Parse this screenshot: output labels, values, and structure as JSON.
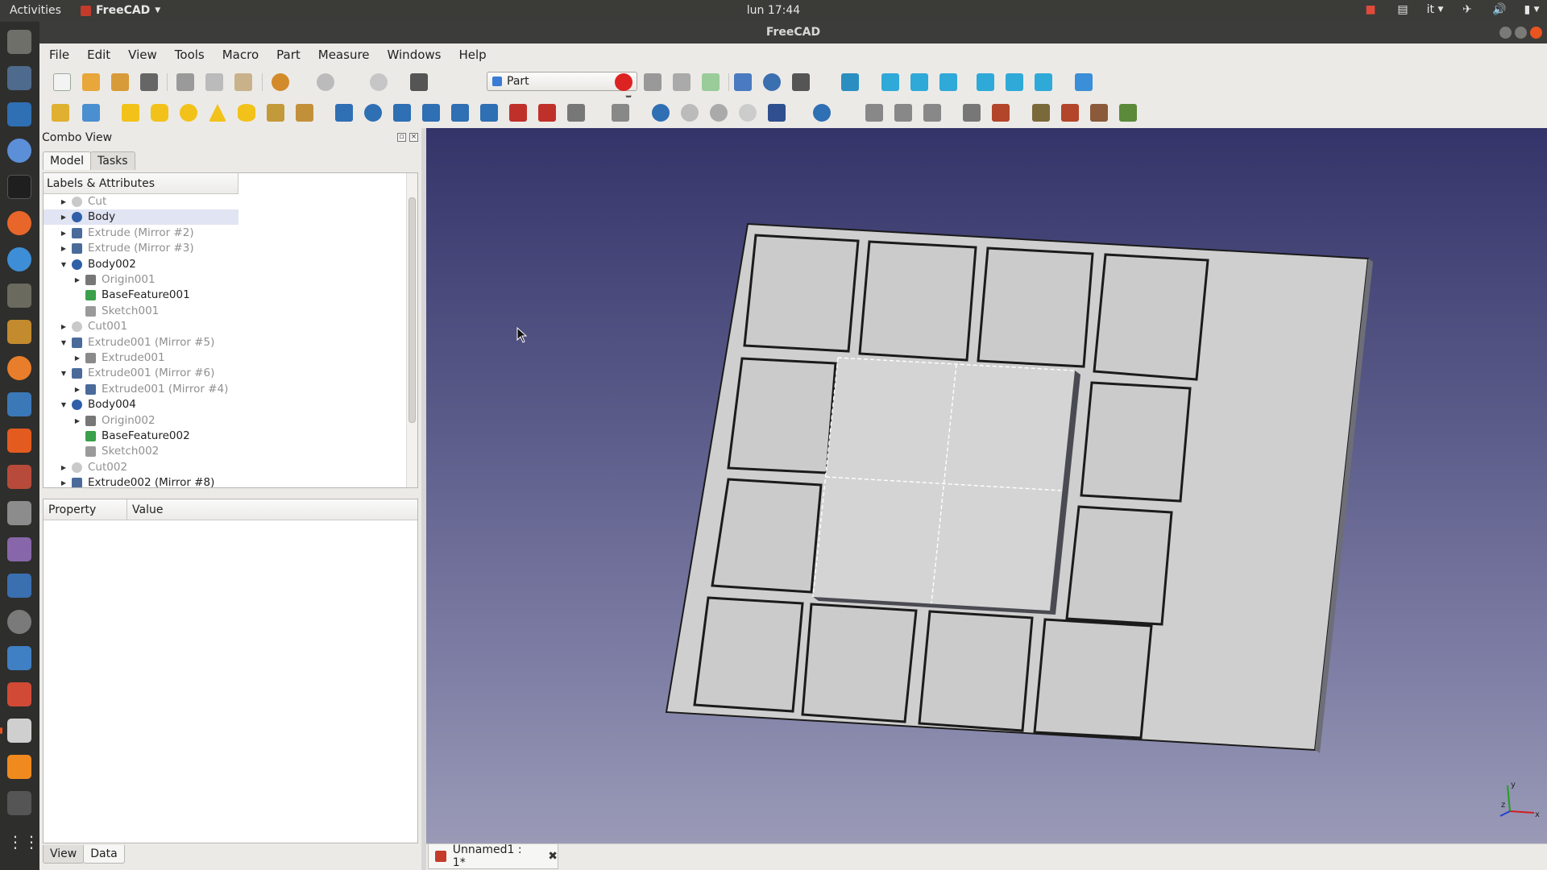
{
  "topbar": {
    "activities": "Activities",
    "app_menu": "FreeCAD",
    "clock": "lun 17:44",
    "keyboard_layout": "it"
  },
  "window": {
    "title": "FreeCAD"
  },
  "menu": [
    "File",
    "Edit",
    "View",
    "Tools",
    "Macro",
    "Part",
    "Measure",
    "Windows",
    "Help"
  ],
  "toolbar": {
    "workbench": "Part"
  },
  "combo": {
    "title": "Combo View",
    "tabs": [
      "Model",
      "Tasks"
    ],
    "tree_header": "Labels & Attributes",
    "items": [
      {
        "label": "Cut",
        "depth": 0,
        "expander": "closed",
        "dim": true,
        "icon": "cut-icon"
      },
      {
        "label": "Body",
        "depth": 0,
        "expander": "closed",
        "dim": false,
        "selected": true,
        "icon": "body-icon"
      },
      {
        "label": "Extrude (Mirror #2)",
        "depth": 0,
        "expander": "closed",
        "dim": true,
        "icon": "mirror-icon"
      },
      {
        "label": "Extrude (Mirror #3)",
        "depth": 0,
        "expander": "closed",
        "dim": true,
        "icon": "mirror-icon"
      },
      {
        "label": "Body002",
        "depth": 0,
        "expander": "open",
        "dim": false,
        "icon": "body-icon"
      },
      {
        "label": "Origin001",
        "depth": 1,
        "expander": "closed",
        "dim": true,
        "icon": "origin-icon"
      },
      {
        "label": "BaseFeature001",
        "depth": 1,
        "expander": "none",
        "dim": false,
        "icon": "base-feature-icon"
      },
      {
        "label": "Sketch001",
        "depth": 1,
        "expander": "none",
        "dim": true,
        "icon": "sketch-icon"
      },
      {
        "label": "Cut001",
        "depth": 0,
        "expander": "closed",
        "dim": true,
        "icon": "cut-icon"
      },
      {
        "label": "Extrude001 (Mirror #5)",
        "depth": 0,
        "expander": "open",
        "dim": true,
        "icon": "mirror-icon"
      },
      {
        "label": "Extrude001",
        "depth": 1,
        "expander": "closed",
        "dim": true,
        "icon": "extrude-icon"
      },
      {
        "label": "Extrude001 (Mirror #6)",
        "depth": 0,
        "expander": "open",
        "dim": true,
        "icon": "mirror-icon"
      },
      {
        "label": "Extrude001 (Mirror #4)",
        "depth": 1,
        "expander": "closed",
        "dim": true,
        "icon": "mirror-icon"
      },
      {
        "label": "Body004",
        "depth": 0,
        "expander": "open",
        "dim": false,
        "icon": "body-icon"
      },
      {
        "label": "Origin002",
        "depth": 1,
        "expander": "closed",
        "dim": true,
        "icon": "origin-icon"
      },
      {
        "label": "BaseFeature002",
        "depth": 1,
        "expander": "none",
        "dim": false,
        "icon": "base-feature-icon"
      },
      {
        "label": "Sketch002",
        "depth": 1,
        "expander": "none",
        "dim": true,
        "icon": "sketch-icon"
      },
      {
        "label": "Cut002",
        "depth": 0,
        "expander": "closed",
        "dim": true,
        "icon": "cut-icon"
      },
      {
        "label": "Extrude002 (Mirror #8)",
        "depth": 0,
        "expander": "closed",
        "dim": false,
        "icon": "mirror-icon"
      }
    ],
    "property_header": "Property",
    "value_header": "Value",
    "bottom_tabs": [
      "View",
      "Data"
    ]
  },
  "document_tab": "Unnamed1 : 1*",
  "axis": {
    "x": "x",
    "y": "y",
    "z": "z"
  },
  "colors": {
    "accent": "#e95420",
    "selection": "#e1e4f3",
    "model_face": "#cfcfcf",
    "viewport_top": "#34346a",
    "viewport_bottom": "#9a9ab7"
  }
}
